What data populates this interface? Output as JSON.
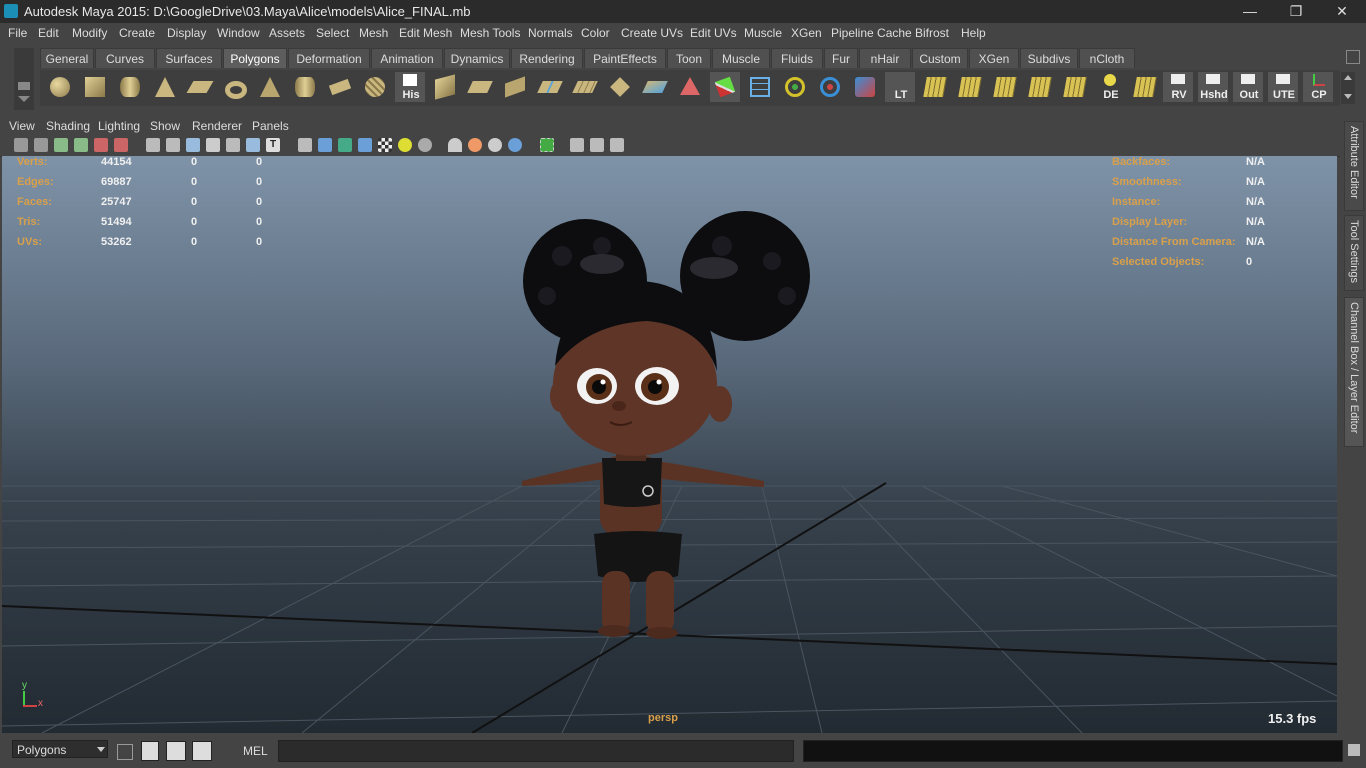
{
  "window": {
    "title": "Autodesk Maya 2015: D:\\GoogleDrive\\03.Maya\\Alice\\models\\Alice_FINAL.mb",
    "minimize": "—",
    "restore": "❐",
    "close": "✕"
  },
  "menubar": [
    "File",
    "Edit",
    "Modify",
    "Create",
    "Display",
    "Window",
    "Assets",
    "Select",
    "Mesh",
    "Edit Mesh",
    "Mesh Tools",
    "Normals",
    "Color",
    "Create UVs",
    "Edit UVs",
    "Muscle",
    "XGen",
    "Pipeline Cache",
    "Bifrost",
    "Help"
  ],
  "shelf": {
    "tabs": [
      "General",
      "Curves",
      "Surfaces",
      "Polygons",
      "Deformation",
      "Animation",
      "Dynamics",
      "Rendering",
      "PaintEffects",
      "Toon",
      "Muscle",
      "Fluids",
      "Fur",
      "nHair",
      "Custom",
      "XGen",
      "Subdivs",
      "nCloth"
    ],
    "active_tab": "Polygons",
    "icon_labels": {
      "his": "His",
      "lt": "LT",
      "de": "DE",
      "rv": "RV",
      "hshd": "Hshd",
      "out": "Out",
      "ute": "UTE",
      "cp": "CP"
    }
  },
  "viewport_menu": [
    "View",
    "Shading",
    "Lighting",
    "Show",
    "Renderer",
    "Panels"
  ],
  "hud": {
    "left_labels": [
      "Verts:",
      "Edges:",
      "Faces:",
      "Tris:",
      "UVs:"
    ],
    "left_col1": [
      "44154",
      "69887",
      "25747",
      "51494",
      "53262"
    ],
    "left_col2": [
      "0",
      "0",
      "0",
      "0",
      "0"
    ],
    "left_col3": [
      "0",
      "0",
      "0",
      "0",
      "0"
    ],
    "right_labels": [
      "Backfaces:",
      "Smoothness:",
      "Instance:",
      "Display Layer:",
      "Distance From Camera:",
      "Selected Objects:"
    ],
    "right_values": [
      "N/A",
      "N/A",
      "N/A",
      "N/A",
      "N/A",
      "0"
    ],
    "camera": "persp",
    "fps": "15.3 fps",
    "axis_y": "y",
    "axis_x": "x"
  },
  "side_tabs": [
    "Attribute Editor",
    "Tool Settings",
    "Channel Box / Layer Editor"
  ],
  "bottom": {
    "mode": "Polygons",
    "mel_label": "MEL"
  },
  "colors": {
    "hud_label": "#d9a04a",
    "accent": "#5d5d5d"
  }
}
